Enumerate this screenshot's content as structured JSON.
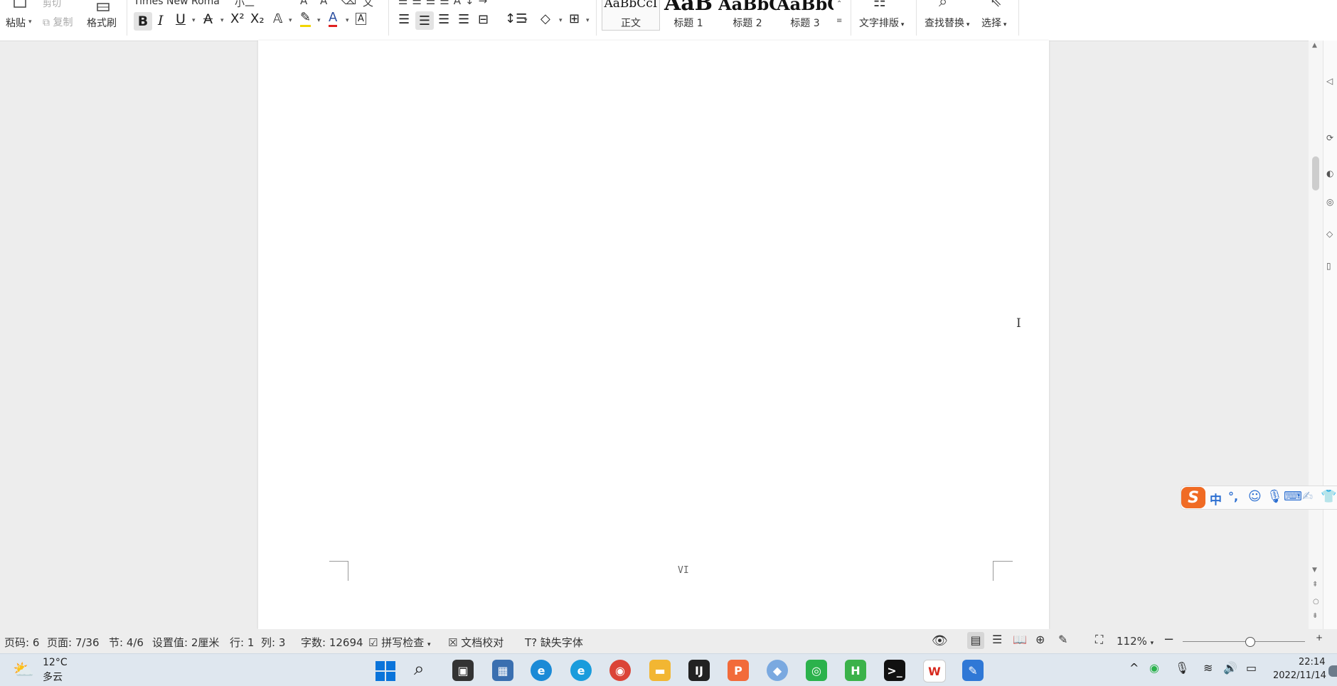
{
  "ribbon": {
    "clipboard": {
      "paste": "粘贴",
      "copy": "复制",
      "cut": "剪切",
      "format_painter": "格式刷"
    },
    "font": {
      "name": "Times New Roma",
      "size": "小二"
    },
    "styles": [
      {
        "sample": "AaBbCcI",
        "name": "正文"
      },
      {
        "sample": "AaB",
        "name": "标题 1"
      },
      {
        "sample": "AaBbC",
        "name": "标题 2"
      },
      {
        "sample": "AaBbC",
        "name": "标题 3"
      }
    ],
    "text_layout": "文字排版",
    "find_replace": "查找替换",
    "select": "选择"
  },
  "document": {
    "page_number_label": "VI"
  },
  "ime": {
    "logo": "S",
    "mode": "中",
    "punct": "°,"
  },
  "status": {
    "page_code": "页码: 6",
    "page": "页面: 7/36",
    "section": "节: 4/6",
    "setting": "设置值: 2厘米",
    "row": "行: 1",
    "col": "列: 3",
    "word_count": "字数: 12694",
    "spell_check": "拼写检查",
    "doc_proof": "文档校对",
    "missing_font": "缺失字体",
    "zoom": "112%",
    "zoom_fraction": 0.55
  },
  "taskbar": {
    "weather_temp": "12°C",
    "weather_desc": "多云",
    "time": "22:14",
    "date": "2022/11/14"
  }
}
